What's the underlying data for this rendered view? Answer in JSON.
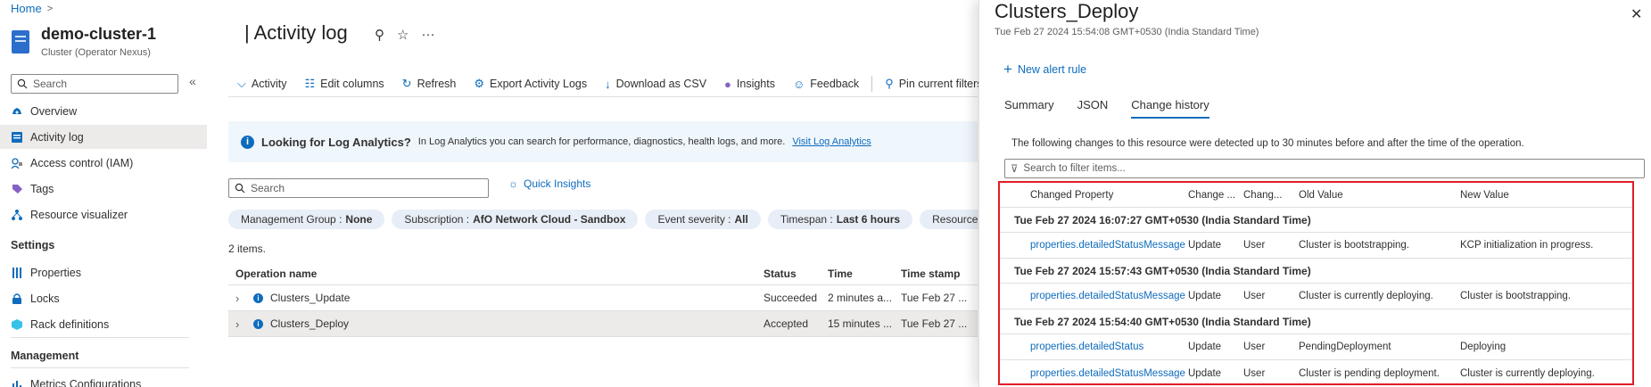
{
  "breadcrumb": {
    "home": "Home",
    "chevron": ">"
  },
  "resource": {
    "title": "demo-cluster-1",
    "subtitle": "Cluster (Operator Nexus)"
  },
  "sidebar": {
    "search_placeholder": "Search",
    "collapse_icon": "«",
    "items": [
      {
        "label": "Overview",
        "icon": "overview-icon"
      },
      {
        "label": "Activity log",
        "icon": "activity-log-icon"
      },
      {
        "label": "Access control (IAM)",
        "icon": "iam-icon"
      },
      {
        "label": "Tags",
        "icon": "tag-icon"
      },
      {
        "label": "Resource visualizer",
        "icon": "visualizer-icon"
      }
    ],
    "settings_heading": "Settings",
    "settings_items": [
      {
        "label": "Properties",
        "icon": "properties-icon"
      },
      {
        "label": "Locks",
        "icon": "lock-icon"
      },
      {
        "label": "Rack definitions",
        "icon": "rack-icon"
      }
    ],
    "management_heading": "Management",
    "management_items": [
      {
        "label": "Metrics Configurations",
        "icon": "metrics-icon"
      }
    ]
  },
  "main": {
    "title": "| Activity log",
    "title_actions": {
      "pin": "⚲",
      "star": "☆",
      "more": "···"
    },
    "toolbar": {
      "activity": "Activity",
      "edit_columns": "Edit columns",
      "refresh": "Refresh",
      "export": "Export Activity Logs",
      "download": "Download as CSV",
      "insights": "Insights",
      "feedback": "Feedback",
      "pin_filters": "Pin current filters",
      "more": "F"
    },
    "banner": {
      "heading": "Looking for Log Analytics?",
      "text": "In Log Analytics you can search for performance, diagnostics, health logs, and more.",
      "link": "Visit Log Analytics"
    },
    "search_placeholder": "Search",
    "quick_insights": "Quick Insights",
    "filters": [
      {
        "label": "Management Group :",
        "value": "None"
      },
      {
        "label": "Subscription :",
        "value": "AfO Network Cloud - Sandbox"
      },
      {
        "label": "Event severity :",
        "value": "All"
      },
      {
        "label": "Timespan :",
        "value": "Last 6 hours"
      },
      {
        "label": "Resource g",
        "value": ""
      }
    ],
    "items_count": "2 items.",
    "table": {
      "headers": {
        "name": "Operation name",
        "status": "Status",
        "time": "Time",
        "stamp": "Time stamp"
      },
      "rows": [
        {
          "name": "Clusters_Update",
          "status": "Succeeded",
          "time": "2 minutes a...",
          "stamp": "Tue Feb 27 ..."
        },
        {
          "name": "Clusters_Deploy",
          "status": "Accepted",
          "time": "15 minutes ...",
          "stamp": "Tue Feb 27 ..."
        }
      ]
    }
  },
  "panel": {
    "title": "Clusters_Deploy",
    "subtitle": "Tue Feb 27 2024 15:54:08 GMT+0530 (India Standard Time)",
    "close": "✕",
    "new_alert": "New alert rule",
    "tabs": [
      "Summary",
      "JSON",
      "Change history"
    ],
    "active_tab": "Change history",
    "note": "The following changes to this resource were detected up to 30 minutes before and after the time of the operation.",
    "filter_placeholder": "Search to filter items...",
    "changes": {
      "headers": {
        "prop": "Changed Property",
        "type": "Change ...",
        "by": "Chang...",
        "old": "Old Value",
        "new": "New Value"
      },
      "groups": [
        {
          "timestamp": "Tue Feb 27 2024 16:07:27 GMT+0530 (India Standard Time)",
          "rows": [
            {
              "prop": "properties.detailedStatusMessage",
              "type": "Update",
              "by": "User",
              "old": "Cluster is bootstrapping.",
              "new": "KCP initialization in progress."
            }
          ]
        },
        {
          "timestamp": "Tue Feb 27 2024 15:57:43 GMT+0530 (India Standard Time)",
          "rows": [
            {
              "prop": "properties.detailedStatusMessage",
              "type": "Update",
              "by": "User",
              "old": "Cluster is currently deploying.",
              "new": "Cluster is bootstrapping."
            }
          ]
        },
        {
          "timestamp": "Tue Feb 27 2024 15:54:40 GMT+0530 (India Standard Time)",
          "rows": [
            {
              "prop": "properties.detailedStatus",
              "type": "Update",
              "by": "User",
              "old": "PendingDeployment",
              "new": "Deploying"
            },
            {
              "prop": "properties.detailedStatusMessage",
              "type": "Update",
              "by": "User",
              "old": "Cluster is pending deployment.",
              "new": "Cluster is currently deploying."
            }
          ]
        }
      ]
    }
  },
  "colors": {
    "accent": "#0f6cbd",
    "highlight_border": "#e01e27",
    "selected_row": "#edebe9"
  }
}
